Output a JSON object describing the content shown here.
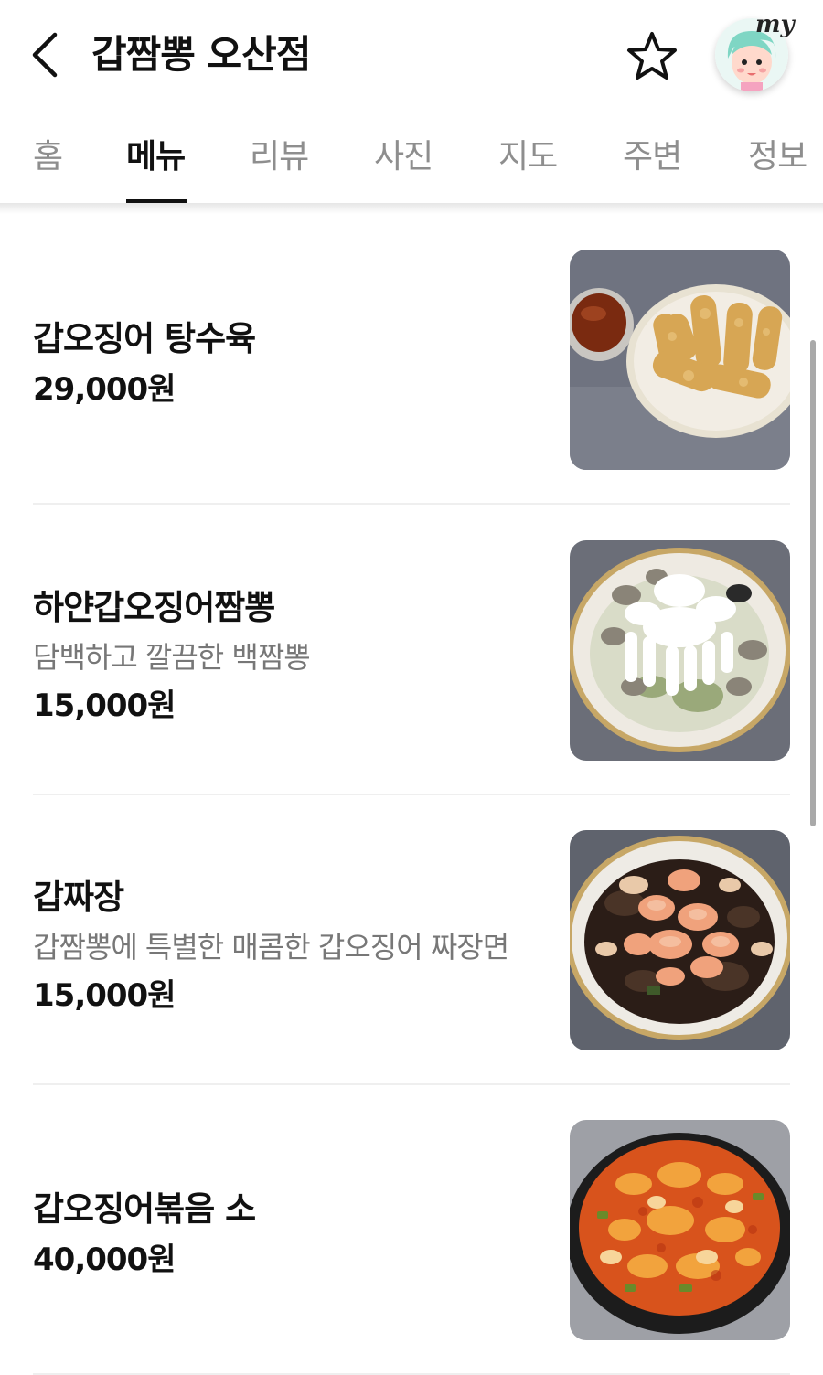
{
  "header": {
    "title": "갑짬뽕 오산점",
    "back_icon": "chevron-left-icon",
    "favorite_icon": "star-outline-icon",
    "my_label": "my"
  },
  "tabs": [
    {
      "label": "홈",
      "active": false
    },
    {
      "label": "메뉴",
      "active": true
    },
    {
      "label": "리뷰",
      "active": false
    },
    {
      "label": "사진",
      "active": false
    },
    {
      "label": "지도",
      "active": false
    },
    {
      "label": "주변",
      "active": false
    },
    {
      "label": "정보",
      "active": false
    }
  ],
  "menu": [
    {
      "name": "갑오징어 탕수육",
      "description": "",
      "price": "29,000원",
      "photo": "fried-squid-photo"
    },
    {
      "name": "하얀갑오징어짬뽕",
      "description": "담백하고 깔끔한 백짬뽕",
      "price": "15,000원",
      "photo": "white-jjamppong-photo"
    },
    {
      "name": "갑짜장",
      "description": "갑짬뽕에 특별한 매콤한 갑오징어 짜장면",
      "price": "15,000원",
      "photo": "jjajang-photo"
    },
    {
      "name": "갑오징어볶음 소",
      "description": "",
      "price": "40,000원",
      "photo": "stir-fried-squid-photo"
    }
  ],
  "colors": {
    "text_primary": "#111111",
    "text_secondary": "#777777",
    "tab_inactive": "#8e8e8e",
    "divider": "#efefef",
    "avatar_hair": "#7fd6c4"
  }
}
